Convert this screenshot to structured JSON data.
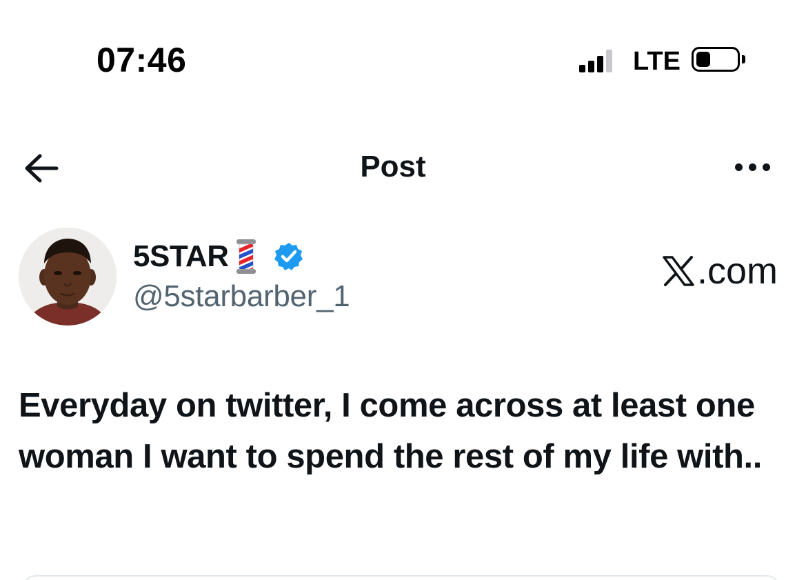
{
  "status_bar": {
    "time": "07:46",
    "network": "LTE",
    "signal_bars_filled": 3,
    "signal_bars_total": 4
  },
  "header": {
    "title": "Post",
    "back_icon": "arrow-left-icon",
    "more_icon": "more-horizontal-icon"
  },
  "author": {
    "display_name": "5STAR",
    "name_emoji": "barber-pole-emoji",
    "verified_icon": "verified-badge-icon",
    "handle": "@5starbarber_1"
  },
  "watermark": {
    "text": ".com",
    "logo": "x-logo-icon"
  },
  "post": {
    "text": "Everyday on twitter, I come across at least one woman I want to spend the rest of my life with.."
  },
  "colors": {
    "text_primary": "#0f1419",
    "text_secondary": "#536471",
    "verified_blue": "#1d9bf0",
    "background": "#ffffff"
  }
}
